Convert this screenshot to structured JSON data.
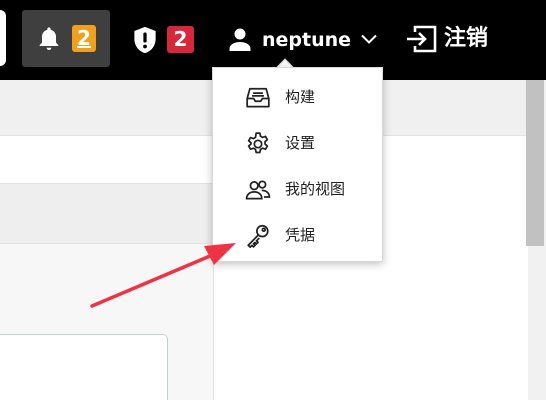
{
  "header": {
    "notifications": {
      "count": "2",
      "badge_color": "#f0a01e"
    },
    "security_alerts": {
      "count": "2",
      "badge_color": "#d8263b"
    },
    "user": {
      "name": "neptune"
    },
    "logout_label": "注销"
  },
  "user_menu": {
    "items": [
      {
        "label": "构建",
        "icon": "inbox-tray-icon"
      },
      {
        "label": "设置",
        "icon": "gear-icon"
      },
      {
        "label": "我的视图",
        "icon": "people-icon"
      },
      {
        "label": "凭据",
        "icon": "key-icon"
      }
    ]
  },
  "annotation": {
    "color": "#ee3344",
    "points_to": "凭据"
  }
}
